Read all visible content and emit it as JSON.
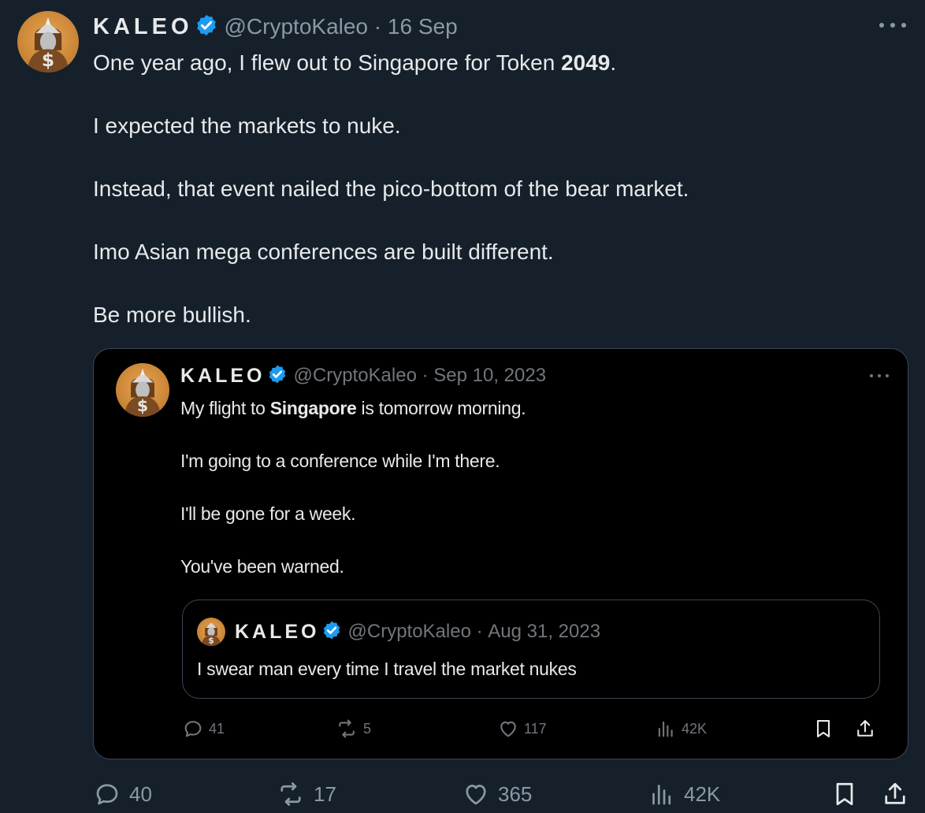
{
  "tweet": {
    "author_name": "KALEO",
    "handle": "@CryptoKaleo",
    "date": "16 Sep",
    "paragraphs": [
      {
        "before": "One year ago, I flew out to Singapore for Token ",
        "bold": "2049",
        "after": "."
      },
      {
        "before": "I expected the markets to nuke.",
        "bold": "",
        "after": ""
      },
      {
        "before": "Instead, that event nailed the pico-bottom of the bear market.",
        "bold": "",
        "after": ""
      },
      {
        "before": "Imo Asian mega conferences are built different.",
        "bold": "",
        "after": ""
      },
      {
        "before": "Be more bullish.",
        "bold": "",
        "after": ""
      }
    ],
    "stats": {
      "replies": "40",
      "reposts": "17",
      "likes": "365",
      "views": "42K"
    }
  },
  "quoted": {
    "author_name": "KALEO",
    "handle": "@CryptoKaleo",
    "date": "Sep 10, 2023",
    "line1_before": "My flight to ",
    "line1_bold": "Singapore",
    "line1_after": " is tomorrow morning.",
    "line2": "I'm going to a conference while I'm there.",
    "line3": "I'll be gone for a week.",
    "line4": "You've been warned.",
    "stats": {
      "replies": "41",
      "reposts": "5",
      "likes": "117",
      "views": "42K"
    }
  },
  "nested_quote": {
    "author_name": "KALEO",
    "handle": "@CryptoKaleo",
    "date": "Aug 31, 2023",
    "text": "I swear man every time I travel the market nukes"
  },
  "colors": {
    "background": "#15202b",
    "quote_background": "#000000",
    "verified_badge": "#1d9bf0",
    "secondary_text": "#8b98a5"
  },
  "separator": " · "
}
